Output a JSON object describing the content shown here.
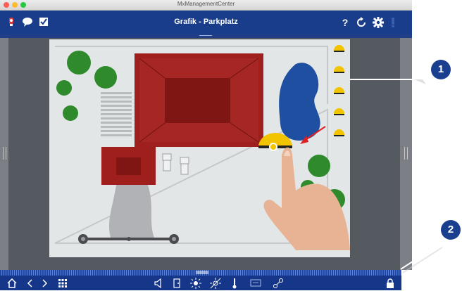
{
  "window": {
    "title": "MxManagementCenter"
  },
  "toolbar": {
    "title": "Grafik - Parkplatz",
    "help_icon": "?",
    "left_icons": [
      "camera-icon",
      "chat-icon",
      "checkbox-icon"
    ],
    "right_icons": [
      "help-icon",
      "refresh-icon",
      "gear-icon",
      "alert-icon"
    ]
  },
  "callouts": {
    "one": "1",
    "two": "2"
  },
  "bottombar": {
    "icons": [
      "home-icon",
      "back-icon",
      "forward-icon",
      "grid-icon",
      "speaker-icon",
      "door-icon",
      "light-icon",
      "light-off-icon",
      "thermometer-icon",
      "display-icon",
      "link-icon",
      "lock-icon"
    ]
  },
  "colors": {
    "toolbar": "#1a3d8b",
    "building": "#9e1f1c",
    "pond": "#1f4fa0",
    "tree": "#2f8a2c",
    "camera": "#f2c400",
    "callout": "#1b3f8f"
  }
}
